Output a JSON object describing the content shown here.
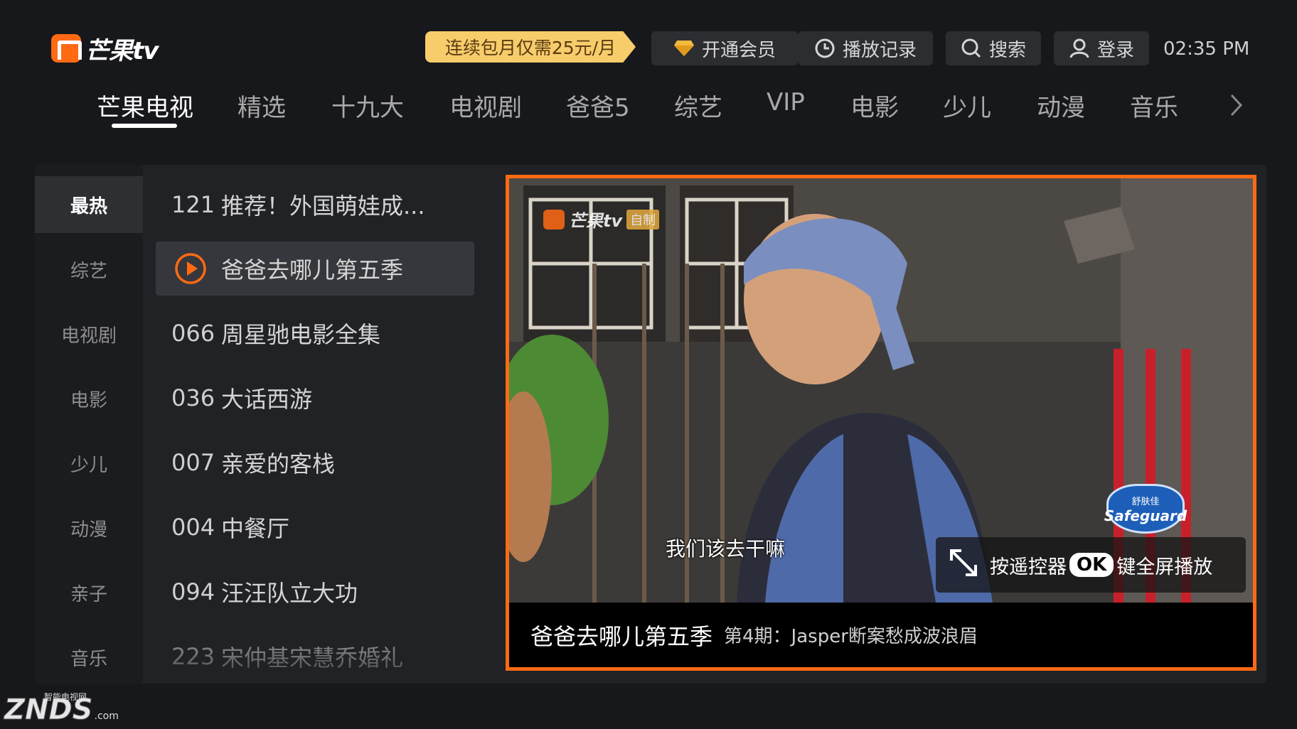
{
  "header": {
    "logo_text": "芒果tv",
    "promo": "连续包月仅需25元/月",
    "buttons": [
      {
        "label": "开通会员",
        "icon": "diamond-icon"
      },
      {
        "label": "播放记录",
        "icon": "clock-icon"
      },
      {
        "label": "搜索",
        "icon": "search-icon"
      },
      {
        "label": "登录",
        "icon": "user-icon"
      }
    ],
    "time": "02:35 PM"
  },
  "nav": {
    "tabs": [
      "芒果电视",
      "精选",
      "十九大",
      "电视剧",
      "爸爸5",
      "综艺",
      "VIP",
      "电影",
      "少儿",
      "动漫",
      "音乐"
    ],
    "active_index": 0
  },
  "categories": {
    "items": [
      "最热",
      "综艺",
      "电视剧",
      "电影",
      "少儿",
      "动漫",
      "亲子",
      "音乐"
    ],
    "active_index": 0
  },
  "channels": [
    {
      "num": "121",
      "title": "推荐！外国萌娃成..."
    },
    {
      "num": "",
      "title": "爸爸去哪儿第五季",
      "playing": true
    },
    {
      "num": "066",
      "title": "周星驰电影全集"
    },
    {
      "num": "036",
      "title": "大话西游"
    },
    {
      "num": "007",
      "title": "亲爱的客栈"
    },
    {
      "num": "004",
      "title": "中餐厅"
    },
    {
      "num": "094",
      "title": "汪汪队立大功"
    },
    {
      "num": "223",
      "title": "宋仲基宋慧乔婚礼"
    }
  ],
  "player": {
    "watermark_text": "芒果tv",
    "watermark_tag": "自制",
    "subtitle": "我们该去干嘛",
    "hint_prefix": "按遥控器",
    "hint_ok": "OK",
    "hint_suffix": "键全屏播放",
    "ad_badge_top": "舒肤佳",
    "ad_badge_main": "Safeguard",
    "show_title": "爸爸去哪儿第五季",
    "episode": "第4期：Jasper断案愁成波浪眉"
  },
  "corner_watermark": {
    "main": "ZNDS",
    "top": "智能电视网",
    "suffix": ".com"
  },
  "colors": {
    "accent": "#ff6a13",
    "promo_bg": "#f7cc6b",
    "background": "#17181b"
  }
}
